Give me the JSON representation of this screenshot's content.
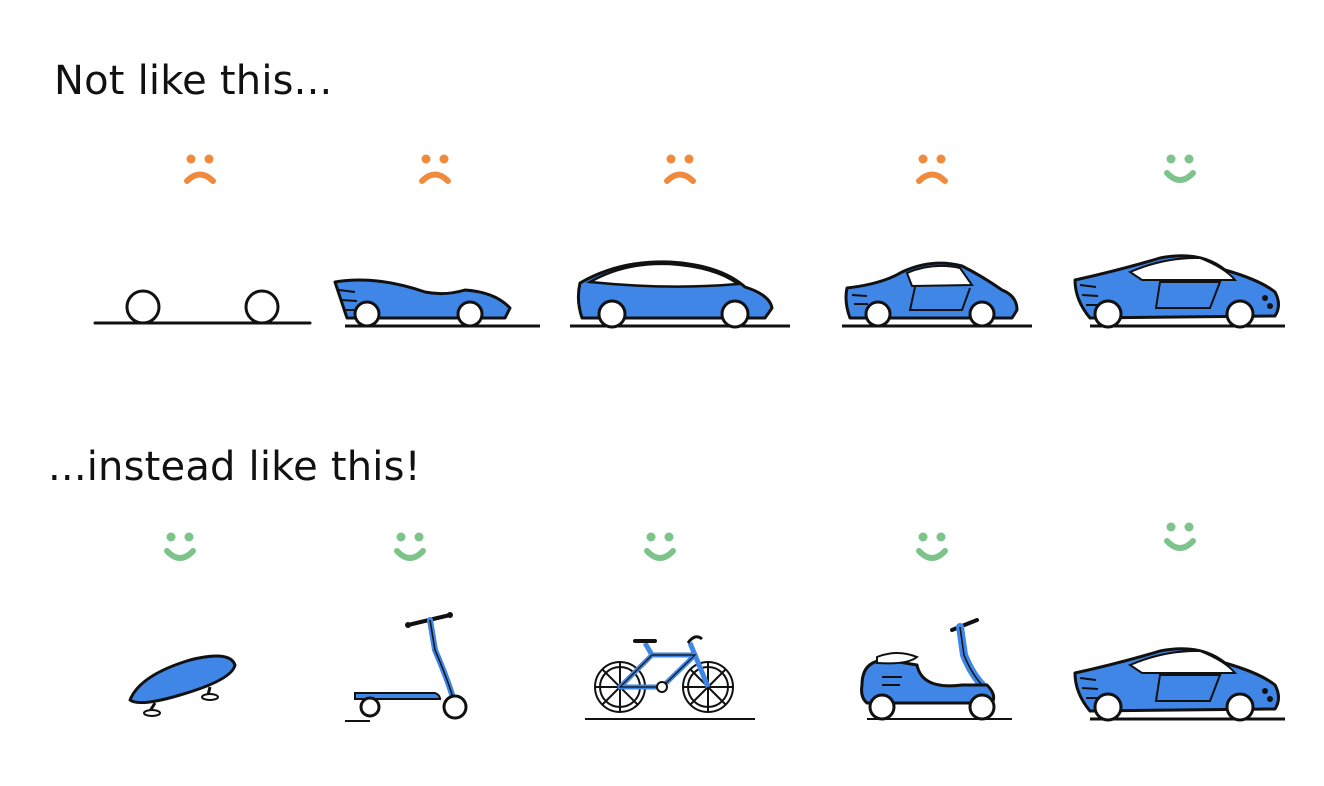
{
  "headings": {
    "top": "Not like this...",
    "bottom": "...instead like this!"
  },
  "colors": {
    "sad": "#f08a3c",
    "happy": "#7cc48a",
    "vehicle_blue": "#3f86e6",
    "ink": "#111111"
  },
  "rows": [
    {
      "name": "not-like-this",
      "items": [
        {
          "stage": "wheels-and-axle",
          "face": "sad"
        },
        {
          "stage": "car-body-shell",
          "face": "sad"
        },
        {
          "stage": "car-with-roof",
          "face": "sad"
        },
        {
          "stage": "car-with-doors",
          "face": "sad"
        },
        {
          "stage": "finished-car",
          "face": "happy"
        }
      ]
    },
    {
      "name": "instead-like-this",
      "items": [
        {
          "stage": "skateboard",
          "face": "happy"
        },
        {
          "stage": "kick-scooter",
          "face": "happy"
        },
        {
          "stage": "bicycle",
          "face": "happy"
        },
        {
          "stage": "motor-scooter",
          "face": "happy"
        },
        {
          "stage": "car",
          "face": "happy"
        }
      ]
    }
  ]
}
